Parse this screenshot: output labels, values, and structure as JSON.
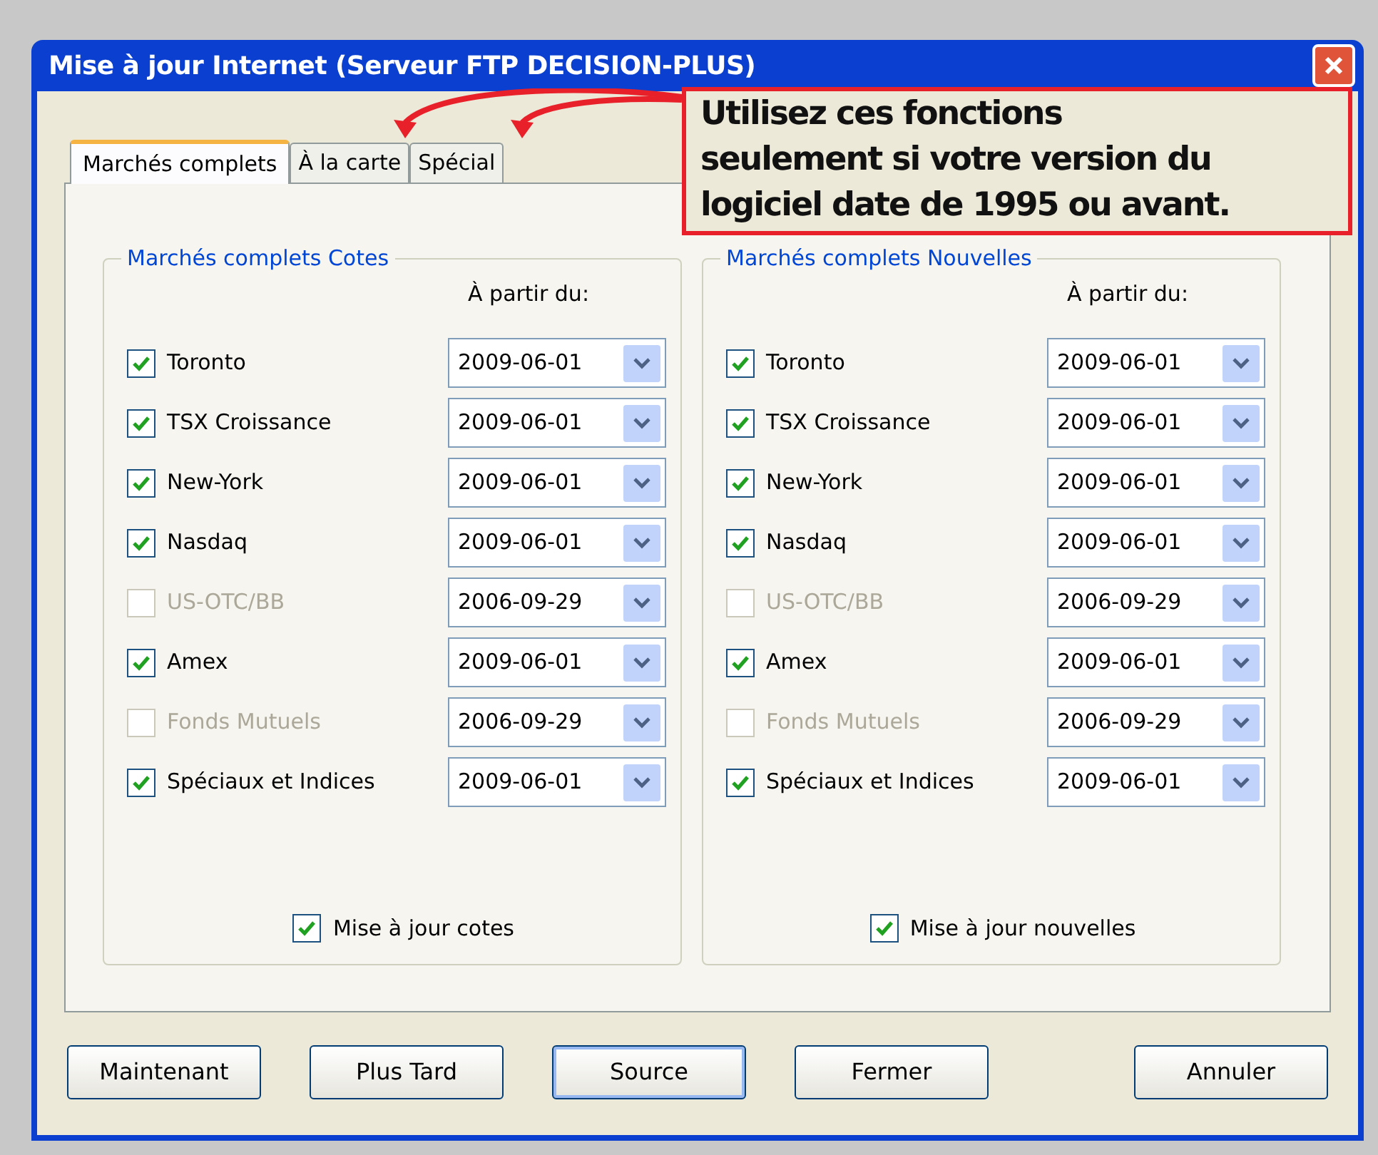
{
  "window": {
    "title": "Mise à jour Internet (Serveur FTP DECISION-PLUS)"
  },
  "tabs": [
    {
      "label": "Marchés complets",
      "selected": true
    },
    {
      "label": "À la carte",
      "selected": false
    },
    {
      "label": "Spécial",
      "selected": false
    }
  ],
  "groups": [
    {
      "title": "Marchés complets Cotes",
      "date_heading": "À partir du:",
      "rows": [
        {
          "label": "Toronto",
          "checked": true,
          "disabled": false,
          "date": "2009-06-01"
        },
        {
          "label": "TSX Croissance",
          "checked": true,
          "disabled": false,
          "date": "2009-06-01"
        },
        {
          "label": "New-York",
          "checked": true,
          "disabled": false,
          "date": "2009-06-01"
        },
        {
          "label": "Nasdaq",
          "checked": true,
          "disabled": false,
          "date": "2009-06-01"
        },
        {
          "label": "US-OTC/BB",
          "checked": false,
          "disabled": true,
          "date": "2006-09-29"
        },
        {
          "label": "Amex",
          "checked": true,
          "disabled": false,
          "date": "2009-06-01"
        },
        {
          "label": "Fonds Mutuels",
          "checked": false,
          "disabled": true,
          "date": "2006-09-29"
        },
        {
          "label": "Spéciaux et Indices",
          "checked": true,
          "disabled": false,
          "date": "2009-06-01"
        }
      ],
      "footer": {
        "label": "Mise à jour cotes",
        "checked": true
      }
    },
    {
      "title": "Marchés complets Nouvelles",
      "date_heading": "À partir du:",
      "rows": [
        {
          "label": "Toronto",
          "checked": true,
          "disabled": false,
          "date": "2009-06-01"
        },
        {
          "label": "TSX Croissance",
          "checked": true,
          "disabled": false,
          "date": "2009-06-01"
        },
        {
          "label": "New-York",
          "checked": true,
          "disabled": false,
          "date": "2009-06-01"
        },
        {
          "label": "Nasdaq",
          "checked": true,
          "disabled": false,
          "date": "2009-06-01"
        },
        {
          "label": "US-OTC/BB",
          "checked": false,
          "disabled": true,
          "date": "2006-09-29"
        },
        {
          "label": "Amex",
          "checked": true,
          "disabled": false,
          "date": "2009-06-01"
        },
        {
          "label": "Fonds Mutuels",
          "checked": false,
          "disabled": true,
          "date": "2006-09-29"
        },
        {
          "label": "Spéciaux et Indices",
          "checked": true,
          "disabled": false,
          "date": "2009-06-01"
        }
      ],
      "footer": {
        "label": "Mise à jour nouvelles",
        "checked": true
      }
    }
  ],
  "buttons": [
    {
      "label": "Maintenant",
      "default": false
    },
    {
      "label": "Plus Tard",
      "default": false
    },
    {
      "label": "Source",
      "default": true
    },
    {
      "label": "Fermer",
      "default": false
    },
    {
      "label": "Annuler",
      "default": false
    }
  ],
  "callout": {
    "text": "Utilisez ces fonctions\nseulement si votre version du\nlogiciel date de 1995 ou avant."
  }
}
